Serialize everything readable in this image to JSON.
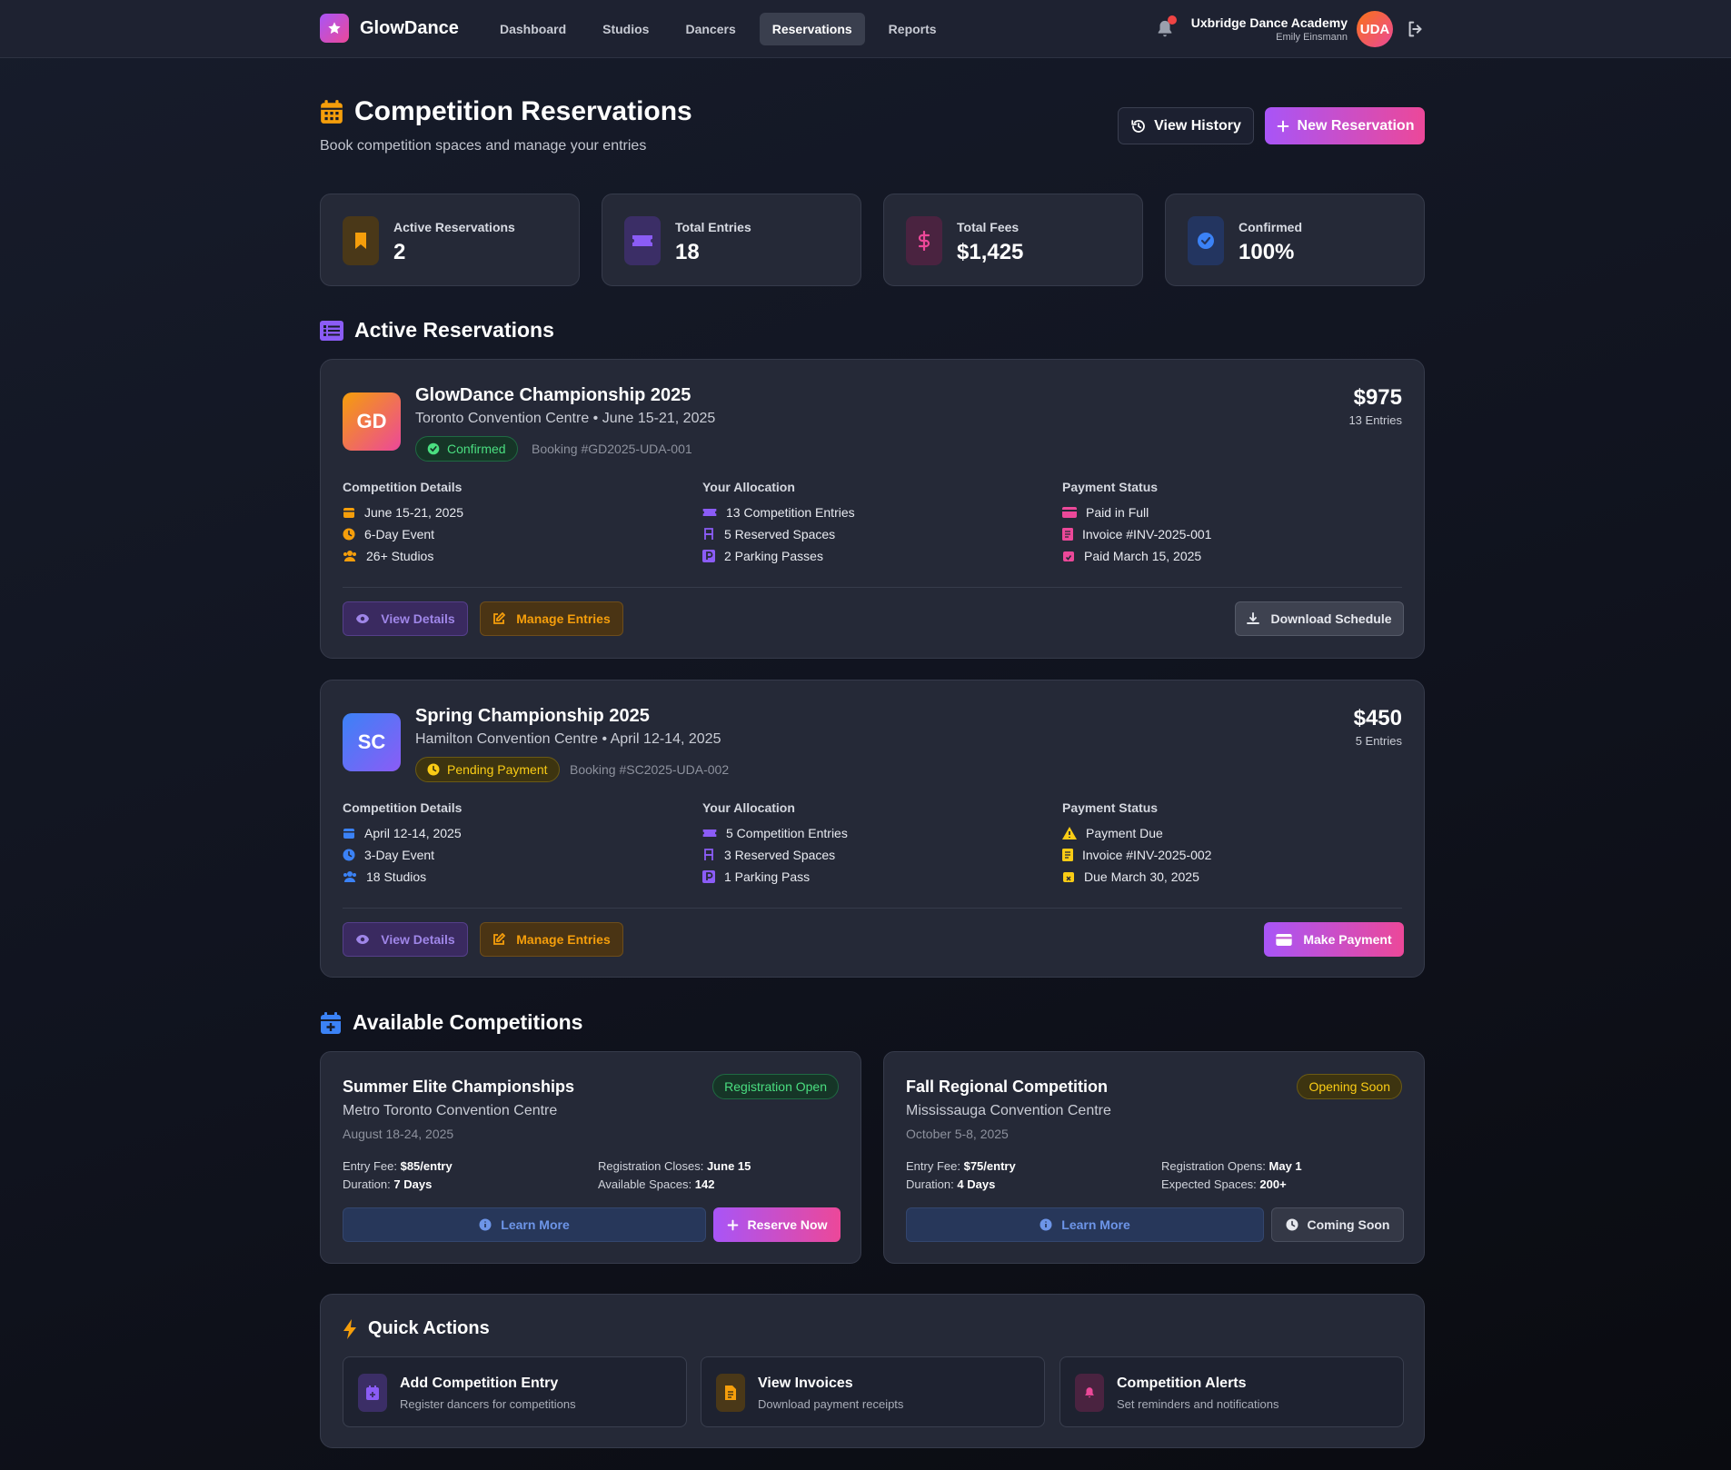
{
  "nav": {
    "brand": "GlowDance",
    "links": [
      "Dashboard",
      "Studios",
      "Dancers",
      "Reservations",
      "Reports"
    ],
    "active": "Reservations",
    "org": "Uxbridge Dance Academy",
    "user": "Emily Einsmann",
    "avatar_initials": "UDA"
  },
  "header": {
    "title": "Competition Reservations",
    "subtitle": "Book competition spaces and manage your entries",
    "history_label": "View History",
    "new_label": "New Reservation"
  },
  "stats": [
    {
      "label": "Active Reservations",
      "value": "2",
      "icon": "bookmark-icon",
      "color": "#f59e0b"
    },
    {
      "label": "Total Entries",
      "value": "18",
      "icon": "ticket-icon",
      "color": "#8b5cf6"
    },
    {
      "label": "Total Fees",
      "value": "$1,425",
      "icon": "dollar-icon",
      "color": "#ec4899"
    },
    {
      "label": "Confirmed",
      "value": "100%",
      "icon": "check-circle-icon",
      "color": "#3b82f6"
    }
  ],
  "sections": {
    "active": "Active Reservations",
    "available": "Available Competitions",
    "quick": "Quick Actions"
  },
  "reservations": [
    {
      "initials": "GD",
      "name": "GlowDance Championship 2025",
      "location": "Toronto Convention Centre • June 15-21, 2025",
      "status": "Confirmed",
      "booking": "Booking #GD2025-UDA-001",
      "amount": "$975",
      "entries": "13 Entries",
      "details_title": "Competition Details",
      "details": [
        "June 15-21, 2025",
        "6-Day Event",
        "26+ Studios"
      ],
      "alloc_title": "Your Allocation",
      "alloc": [
        "13 Competition Entries",
        "5 Reserved Spaces",
        "2 Parking Passes"
      ],
      "pay_title": "Payment Status",
      "pay": [
        "Paid in Full",
        "Invoice #INV-2025-001",
        "Paid March 15, 2025"
      ],
      "view_label": "View Details",
      "manage_label": "Manage Entries",
      "right_label": "Download Schedule"
    },
    {
      "initials": "SC",
      "name": "Spring Championship 2025",
      "location": "Hamilton Convention Centre • April 12-14, 2025",
      "status": "Pending Payment",
      "booking": "Booking #SC2025-UDA-002",
      "amount": "$450",
      "entries": "5 Entries",
      "details_title": "Competition Details",
      "details": [
        "April 12-14, 2025",
        "3-Day Event",
        "18 Studios"
      ],
      "alloc_title": "Your Allocation",
      "alloc": [
        "5 Competition Entries",
        "3 Reserved Spaces",
        "1 Parking Pass"
      ],
      "pay_title": "Payment Status",
      "pay": [
        "Payment Due",
        "Invoice #INV-2025-002",
        "Due March 30, 2025"
      ],
      "view_label": "View Details",
      "manage_label": "Manage Entries",
      "right_label": "Make Payment"
    }
  ],
  "competitions": [
    {
      "name": "Summer Elite Championships",
      "venue": "Metro Toronto Convention Centre",
      "dates": "August 18-24, 2025",
      "badge": "Registration Open",
      "fee_label": "Entry Fee:",
      "fee": "$85/entry",
      "duration_label": "Duration:",
      "duration": "7 Days",
      "reg_label": "Registration Closes:",
      "reg": "June 15",
      "spaces_label": "Available Spaces:",
      "spaces": "142",
      "learn_label": "Learn More",
      "action_label": "Reserve Now"
    },
    {
      "name": "Fall Regional Competition",
      "venue": "Mississauga Convention Centre",
      "dates": "October 5-8, 2025",
      "badge": "Opening Soon",
      "fee_label": "Entry Fee:",
      "fee": "$75/entry",
      "duration_label": "Duration:",
      "duration": "4 Days",
      "reg_label": "Registration Opens:",
      "reg": "May 1",
      "spaces_label": "Expected Spaces:",
      "spaces": "200+",
      "learn_label": "Learn More",
      "action_label": "Coming Soon"
    }
  ],
  "quick_actions": [
    {
      "name": "Add Competition Entry",
      "desc": "Register dancers for competitions",
      "icon": "calendar-plus-icon",
      "color": "#8b5cf6"
    },
    {
      "name": "View Invoices",
      "desc": "Download payment receipts",
      "icon": "invoice-icon",
      "color": "#f59e0b"
    },
    {
      "name": "Competition Alerts",
      "desc": "Set reminders and notifications",
      "icon": "bell-icon",
      "color": "#ec4899"
    }
  ]
}
